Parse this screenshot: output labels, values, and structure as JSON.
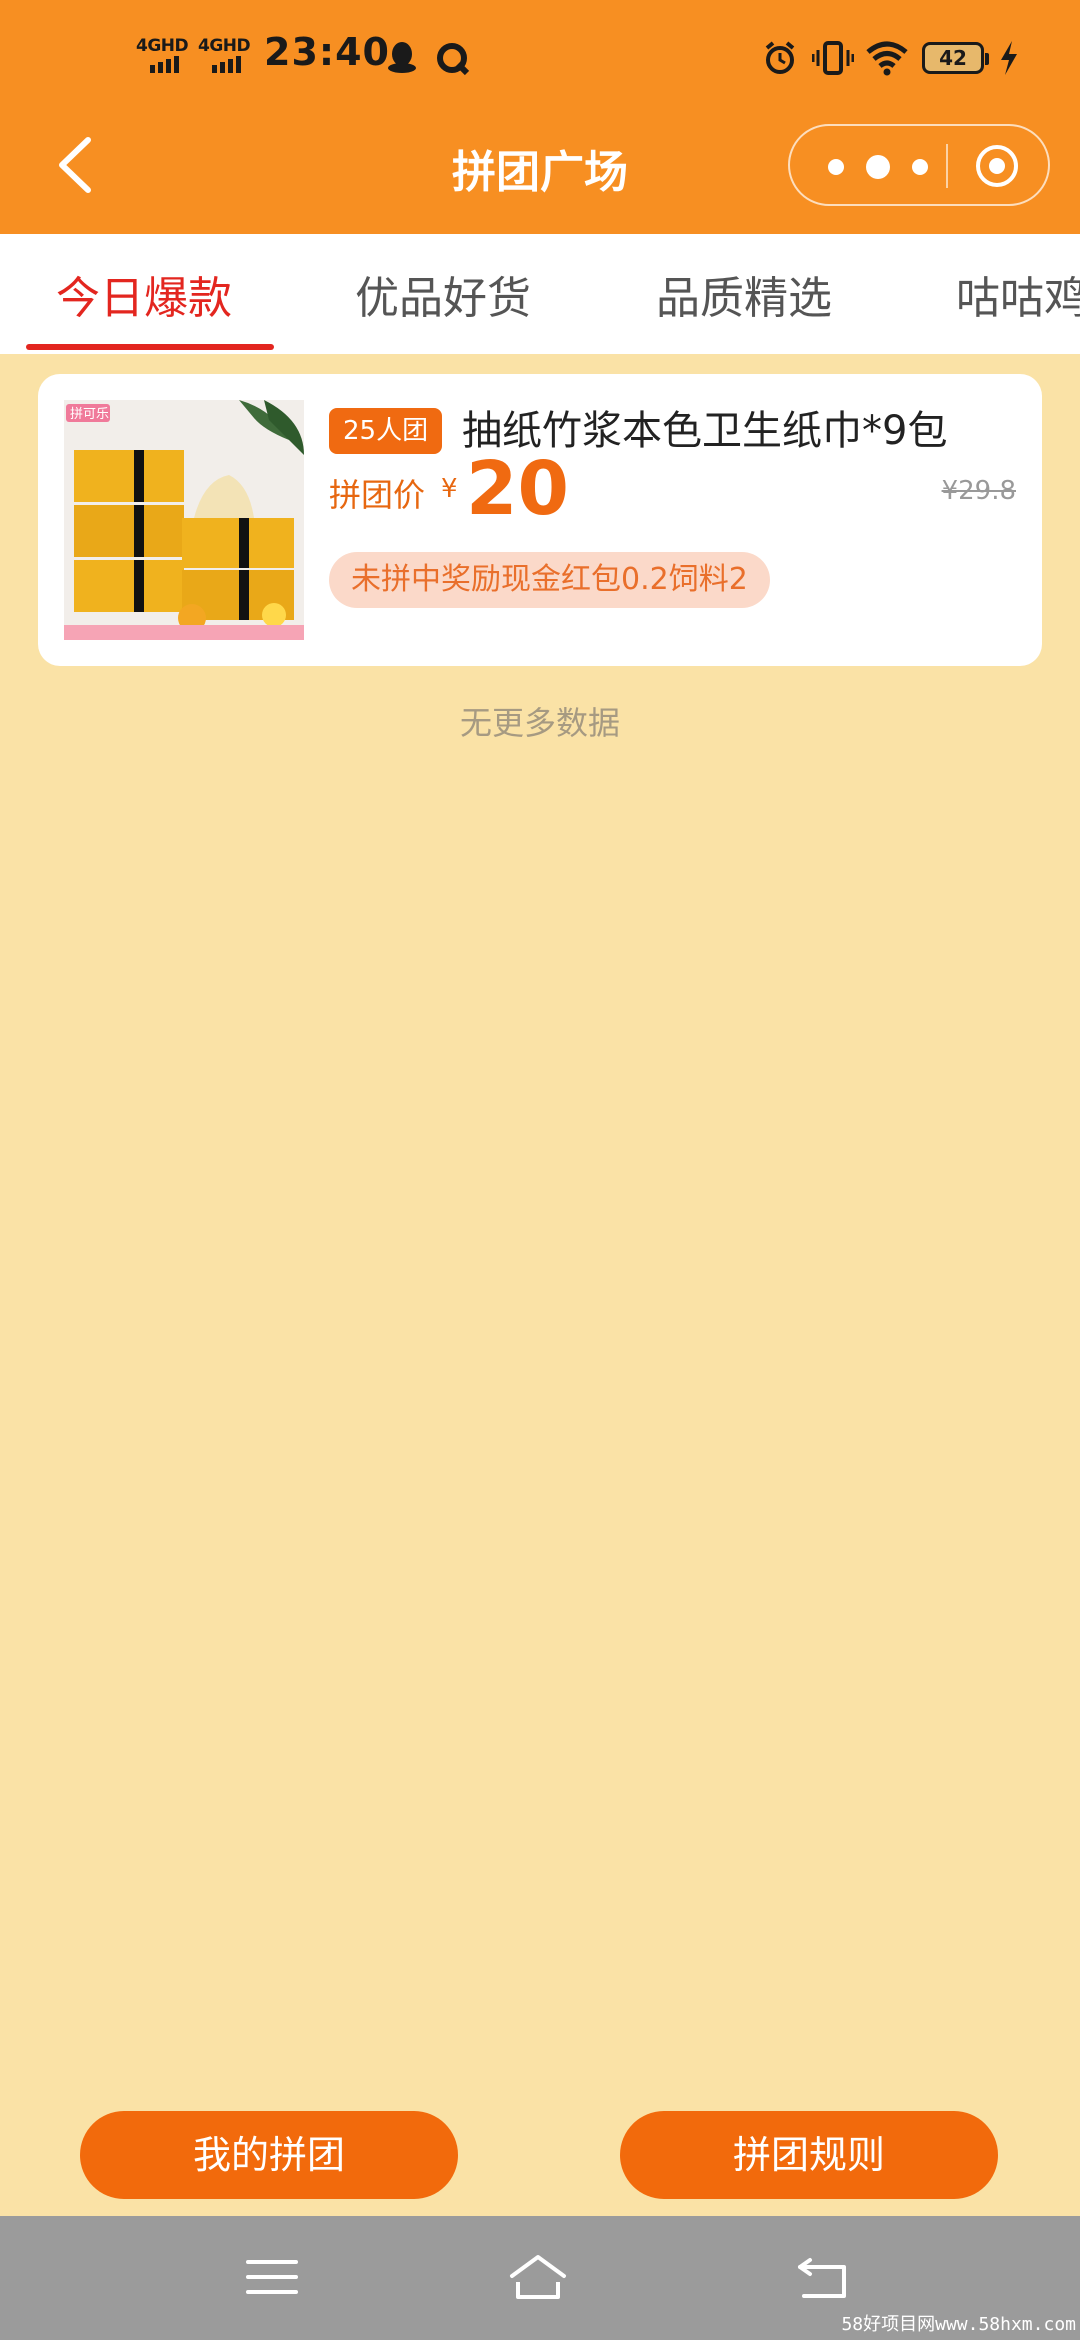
{
  "status_bar": {
    "signal1_label": "4GHD",
    "signal2_label": "4GHD",
    "time": "23:40",
    "battery": "42"
  },
  "header": {
    "title": "拼团广场"
  },
  "tabs": [
    {
      "label": "今日爆款",
      "active": true
    },
    {
      "label": "优品好货",
      "active": false
    },
    {
      "label": "品质精选",
      "active": false
    },
    {
      "label": "咕咕鸡",
      "active": false
    }
  ],
  "product": {
    "group_badge": "25人团",
    "name": "抽纸竹浆本色卫生纸巾*9包",
    "price_label": "拼团价",
    "currency": "¥",
    "price": "20",
    "original_price": "¥29.8",
    "reward_text": "未拼中奖励现金红包0.2饲料2",
    "image_brand_text": "拼可乐"
  },
  "list_end_text": "无更多数据",
  "buttons": {
    "my_groups": "我的拼团",
    "rules": "拼团规则"
  },
  "watermark": "58好项目网www.58hxm.com",
  "colors": {
    "header_bg": "#F78F22",
    "page_bg": "#FAE2A6",
    "accent": "#F06A11",
    "tab_active": "#E3261F",
    "system_nav_bg": "#9B9B9B"
  }
}
